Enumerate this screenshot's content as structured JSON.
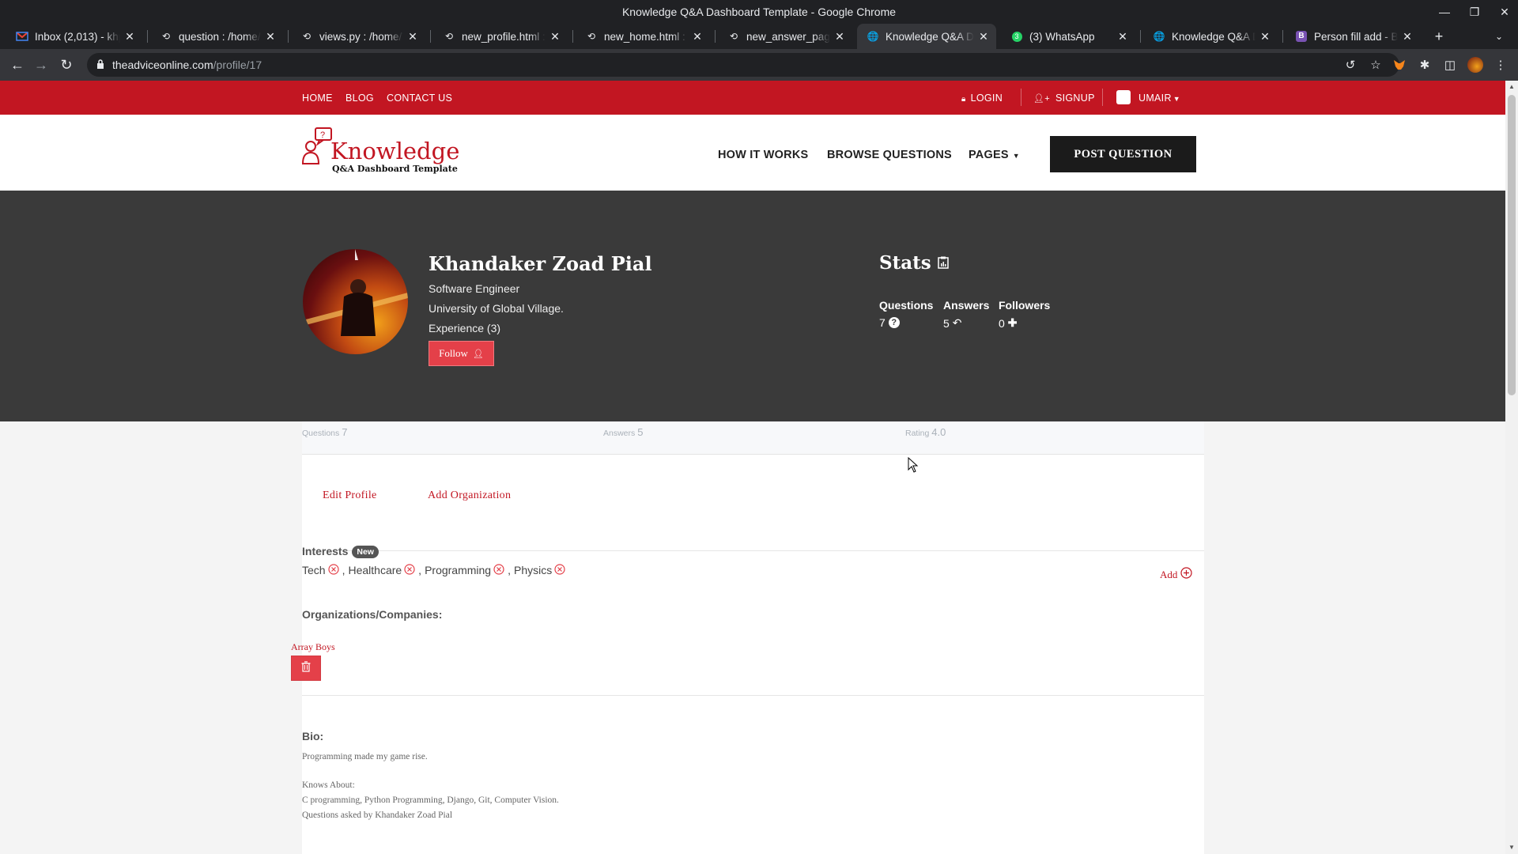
{
  "browser": {
    "window_title": "Knowledge Q&A Dashboard Template - Google Chrome",
    "tabs": [
      {
        "label": "Inbox (2,013) - khp",
        "icon": "gmail-icon"
      },
      {
        "label": "question : /home/T",
        "icon": "pythonanywhere-icon"
      },
      {
        "label": "views.py : /home/T",
        "icon": "pythonanywhere-icon"
      },
      {
        "label": "new_profile.html :",
        "icon": "pythonanywhere-icon"
      },
      {
        "label": "new_home.html : /",
        "icon": "pythonanywhere-icon"
      },
      {
        "label": "new_answer_page",
        "icon": "pythonanywhere-icon"
      },
      {
        "label": "Knowledge Q&A D",
        "icon": "globe-icon",
        "active": true
      },
      {
        "label": "(3) WhatsApp",
        "icon": "whatsapp-icon"
      },
      {
        "label": "Knowledge Q&A D",
        "icon": "globe-icon"
      },
      {
        "label": "Person fill add - B",
        "icon": "bootstrap-icon"
      }
    ],
    "url_domain": "theadviceonline.com",
    "url_path": "/profile/17"
  },
  "topbar": {
    "links": [
      "HOME",
      "BLOG",
      "CONTACT US"
    ],
    "login": "LOGIN",
    "signup": "SIGNUP",
    "user": "UMAIR"
  },
  "header": {
    "logo_word": "Knowledge",
    "logo_sub": "Q&A Dashboard Template",
    "nav": [
      "HOW IT WORKS",
      "BROWSE QUESTIONS",
      "PAGES"
    ],
    "post_button": "POST QUESTION"
  },
  "profile": {
    "name": "Khandaker Zoad Pial",
    "title": "Software Engineer",
    "university": "University of Global Village.",
    "experience": "Experience (3)",
    "follow_label": "Follow"
  },
  "stats": {
    "heading": "Stats",
    "questions_label": "Questions",
    "questions_value": "7",
    "answers_label": "Answers",
    "answers_value": "5",
    "followers_label": "Followers",
    "followers_value": "0"
  },
  "counts": {
    "questions_label": "Questions",
    "questions_value": "7",
    "answers_label": "Answers",
    "answers_value": "5",
    "rating_label": "Rating",
    "rating_value": "4.0"
  },
  "actions": {
    "edit_profile": "Edit Profile",
    "add_organization": "Add Organization"
  },
  "interests": {
    "heading": "Interests",
    "badge": "New",
    "add_label": "Add",
    "items": [
      "Tech",
      "Healthcare",
      "Programming",
      "Physics"
    ]
  },
  "organizations": {
    "heading": "Organizations/Companies:",
    "items": [
      "Array Boys"
    ]
  },
  "bio": {
    "heading": "Bio:",
    "text": "Programming made my game rise.",
    "knows_about_label": "Knows About:",
    "knows_about": "C programming, Python Programming, Django, Git, Computer Vision.",
    "questions_asked": "Questions asked by Khandaker Zoad Pial"
  },
  "colors": {
    "brand_red": "#c21622",
    "button_red": "#e44049",
    "hero_bg": "#3a3a3a",
    "chrome_dark": "#202124"
  }
}
